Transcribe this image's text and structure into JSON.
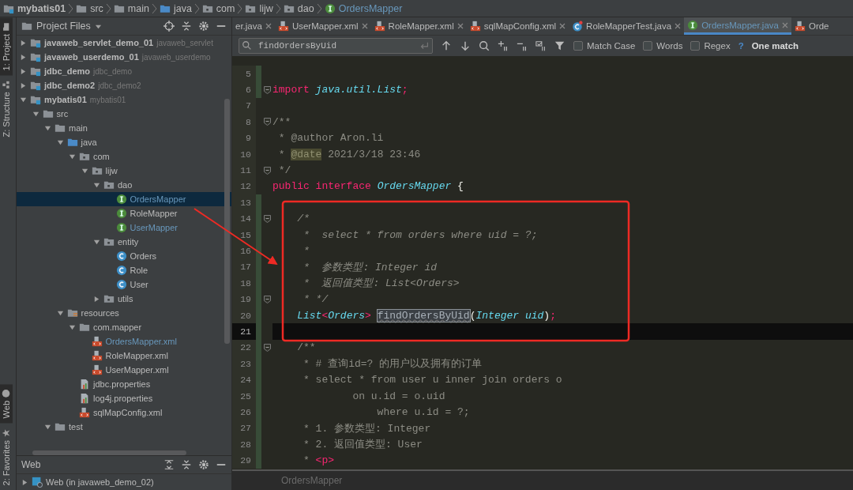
{
  "breadcrumb": [
    {
      "label": "mybatis01",
      "kind": "module"
    },
    {
      "label": "src",
      "kind": "folder"
    },
    {
      "label": "main",
      "kind": "folder"
    },
    {
      "label": "java",
      "kind": "source"
    },
    {
      "label": "com",
      "kind": "package"
    },
    {
      "label": "lijw",
      "kind": "package"
    },
    {
      "label": "dao",
      "kind": "package"
    },
    {
      "label": "OrdersMapper",
      "kind": "interface"
    }
  ],
  "tool_strip": {
    "top": [
      {
        "label": "1: Project",
        "kind": "project",
        "selected": true
      },
      {
        "label": "Z: Structure",
        "kind": "structure",
        "selected": false
      }
    ],
    "bottom": [
      {
        "label": "Web",
        "kind": "web",
        "selected": true
      },
      {
        "label": "2: Favorites",
        "kind": "favorites",
        "selected": false
      }
    ]
  },
  "project_panel": {
    "title": "Project Files",
    "tree": [
      {
        "label": "javaweb_servlet_demo_01",
        "module": "javaweb_servlet",
        "kind": "module",
        "expanded": false,
        "selected": false,
        "modified": false
      },
      {
        "label": "javaweb_userdemo_01",
        "module": "javaweb_userdemo",
        "kind": "module",
        "expanded": false,
        "selected": false,
        "modified": false
      },
      {
        "label": "jdbc_demo",
        "module": "jdbc_demo",
        "kind": "module",
        "expanded": false,
        "selected": false,
        "modified": false
      },
      {
        "label": "jdbc_demo2",
        "module": "jdbc_demo2",
        "kind": "module",
        "expanded": false,
        "selected": false,
        "modified": false
      },
      {
        "label": "mybatis01",
        "module": "mybatis01",
        "kind": "module",
        "expanded": true,
        "selected": false,
        "modified": false,
        "children": [
          {
            "label": "src",
            "kind": "folder",
            "expanded": true,
            "selected": false,
            "modified": false,
            "children": [
              {
                "label": "main",
                "kind": "folder",
                "expanded": true,
                "selected": false,
                "modified": false,
                "children": [
                  {
                    "label": "java",
                    "kind": "source",
                    "expanded": true,
                    "selected": false,
                    "modified": false,
                    "children": [
                      {
                        "label": "com",
                        "kind": "package",
                        "expanded": true,
                        "selected": false,
                        "modified": false,
                        "children": [
                          {
                            "label": "lijw",
                            "kind": "package",
                            "expanded": true,
                            "selected": false,
                            "modified": false,
                            "children": [
                              {
                                "label": "dao",
                                "kind": "package",
                                "expanded": true,
                                "selected": false,
                                "modified": false,
                                "children": [
                                  {
                                    "label": "OrdersMapper",
                                    "kind": "interface",
                                    "selected": true,
                                    "modified": true
                                  },
                                  {
                                    "label": "RoleMapper",
                                    "kind": "interface",
                                    "selected": false,
                                    "modified": false
                                  },
                                  {
                                    "label": "UserMapper",
                                    "kind": "interface",
                                    "selected": false,
                                    "modified": true
                                  }
                                ]
                              },
                              {
                                "label": "entity",
                                "kind": "package",
                                "expanded": true,
                                "selected": false,
                                "modified": false,
                                "children": [
                                  {
                                    "label": "Orders",
                                    "kind": "class",
                                    "selected": false,
                                    "modified": false
                                  },
                                  {
                                    "label": "Role",
                                    "kind": "class",
                                    "selected": false,
                                    "modified": false
                                  },
                                  {
                                    "label": "User",
                                    "kind": "class",
                                    "selected": false,
                                    "modified": false
                                  }
                                ]
                              },
                              {
                                "label": "utils",
                                "kind": "package",
                                "expanded": false,
                                "selected": false,
                                "modified": false
                              }
                            ]
                          }
                        ]
                      }
                    ]
                  },
                  {
                    "label": "resources",
                    "kind": "resources",
                    "expanded": true,
                    "selected": false,
                    "modified": false,
                    "children": [
                      {
                        "label": "com.mapper",
                        "kind": "folder",
                        "expanded": true,
                        "selected": false,
                        "modified": false,
                        "children": [
                          {
                            "label": "OrdersMapper.xml",
                            "kind": "xml",
                            "selected": false,
                            "modified": true
                          },
                          {
                            "label": "RoleMapper.xml",
                            "kind": "xml",
                            "selected": false,
                            "modified": false
                          },
                          {
                            "label": "UserMapper.xml",
                            "kind": "xml",
                            "selected": false,
                            "modified": false
                          }
                        ]
                      },
                      {
                        "label": "jdbc.properties",
                        "kind": "properties",
                        "selected": false,
                        "modified": false
                      },
                      {
                        "label": "log4j.properties",
                        "kind": "properties",
                        "selected": false,
                        "modified": false
                      },
                      {
                        "label": "sqlMapConfig.xml",
                        "kind": "xml",
                        "selected": false,
                        "modified": false
                      }
                    ]
                  }
                ]
              },
              {
                "label": "test",
                "kind": "folder",
                "expanded": true,
                "selected": false,
                "modified": false
              }
            ]
          }
        ]
      }
    ]
  },
  "web_panel": {
    "title": "Web",
    "items": [
      {
        "label": "Web (in javaweb_demo_02)",
        "kind": "web",
        "expanded": false
      }
    ]
  },
  "tabs": [
    {
      "label": "er.java",
      "kind": "none",
      "selected": false,
      "closable": true
    },
    {
      "label": "UserMapper.xml",
      "kind": "xml",
      "selected": false,
      "closable": true
    },
    {
      "label": "RoleMapper.xml",
      "kind": "xml",
      "selected": false,
      "closable": true
    },
    {
      "label": "sqlMapConfig.xml",
      "kind": "xml",
      "selected": false,
      "closable": true
    },
    {
      "label": "RoleMapperTest.java",
      "kind": "test-class",
      "selected": false,
      "closable": true
    },
    {
      "label": "OrdersMapper.java",
      "kind": "interface",
      "selected": true,
      "closable": true
    },
    {
      "label": "Orde",
      "kind": "xml",
      "selected": false,
      "closable": false
    }
  ],
  "find_bar": {
    "value": "findOrdersByUid",
    "options": [
      {
        "label": "Match Case",
        "checked": false
      },
      {
        "label": "Words",
        "checked": false
      },
      {
        "label": "Regex",
        "checked": false
      }
    ],
    "help": "?",
    "result": "One match"
  },
  "editor": {
    "lines": [
      {
        "number": "5",
        "changed": true,
        "fold": false,
        "current": false
      },
      {
        "number": "6",
        "changed": true,
        "fold": true,
        "current": false,
        "tokens": [
          {
            "text": "import ",
            "kind": "keyword"
          },
          {
            "text": "java.util.List",
            "kind": "type"
          },
          {
            "text": ";",
            "kind": "keyword"
          }
        ]
      },
      {
        "number": "7",
        "changed": false,
        "fold": false,
        "current": false
      },
      {
        "number": "8",
        "changed": false,
        "fold": true,
        "current": false,
        "tokens": [
          {
            "text": "/**",
            "kind": "doc"
          }
        ]
      },
      {
        "number": "9",
        "changed": false,
        "fold": false,
        "current": false,
        "tokens": [
          {
            "text": " * @author Aron.li",
            "kind": "doc"
          }
        ]
      },
      {
        "number": "10",
        "changed": false,
        "fold": false,
        "current": false,
        "tokens": [
          {
            "text": " * ",
            "kind": "doc"
          },
          {
            "text": "@date",
            "kind": "doc_tag"
          },
          {
            "text": " 2021/3/18 23:46",
            "kind": "doc"
          }
        ]
      },
      {
        "number": "11",
        "changed": false,
        "fold": true,
        "current": false,
        "tokens": [
          {
            "text": " */",
            "kind": "doc"
          }
        ]
      },
      {
        "number": "12",
        "changed": false,
        "fold": false,
        "current": false,
        "tokens": [
          {
            "text": "public interface ",
            "kind": "keyword"
          },
          {
            "text": "OrdersMapper",
            "kind": "type"
          },
          {
            "text": " {",
            "kind": "plain"
          }
        ]
      },
      {
        "number": "13",
        "changed": true,
        "fold": false,
        "current": false
      },
      {
        "number": "14",
        "changed": true,
        "fold": true,
        "current": false,
        "tokens": [
          {
            "text": "    /*",
            "kind": "comment"
          }
        ]
      },
      {
        "number": "15",
        "changed": true,
        "fold": false,
        "current": false,
        "tokens": [
          {
            "text": "     *  select * from orders where uid = ?;",
            "kind": "comment"
          }
        ]
      },
      {
        "number": "16",
        "changed": true,
        "fold": false,
        "current": false,
        "tokens": [
          {
            "text": "     *",
            "kind": "comment"
          }
        ]
      },
      {
        "number": "17",
        "changed": true,
        "fold": false,
        "current": false,
        "tokens": [
          {
            "text": "     *  参数类型: Integer id",
            "kind": "comment"
          }
        ]
      },
      {
        "number": "18",
        "changed": true,
        "fold": false,
        "current": false,
        "tokens": [
          {
            "text": "     *  返回值类型: List<Orders>",
            "kind": "comment"
          }
        ]
      },
      {
        "number": "19",
        "changed": true,
        "fold": true,
        "current": false,
        "tokens": [
          {
            "text": "     * */",
            "kind": "comment"
          }
        ]
      },
      {
        "number": "20",
        "changed": true,
        "fold": false,
        "current": false,
        "tokens": [
          {
            "text": "    List",
            "kind": "type"
          },
          {
            "text": "<",
            "kind": "keyword"
          },
          {
            "text": "Orders",
            "kind": "type"
          },
          {
            "text": "> ",
            "kind": "keyword"
          },
          {
            "text": "findOrdersByUid",
            "kind": "match"
          },
          {
            "text": "(",
            "kind": "plain"
          },
          {
            "text": "Integer uid",
            "kind": "type"
          },
          {
            "text": ")",
            "kind": "plain"
          },
          {
            "text": ";",
            "kind": "keyword"
          }
        ]
      },
      {
        "number": "21",
        "changed": true,
        "fold": false,
        "current": true
      },
      {
        "number": "22",
        "changed": true,
        "fold": true,
        "current": false,
        "tokens": [
          {
            "text": "    /**",
            "kind": "doc"
          }
        ]
      },
      {
        "number": "23",
        "changed": true,
        "fold": false,
        "current": false,
        "tokens": [
          {
            "text": "     * # 查询id=? 的用户以及拥有的订单",
            "kind": "doc"
          }
        ]
      },
      {
        "number": "24",
        "changed": true,
        "fold": false,
        "current": false,
        "tokens": [
          {
            "text": "     * select * from user u inner join orders o",
            "kind": "doc"
          }
        ]
      },
      {
        "number": "25",
        "changed": true,
        "fold": false,
        "current": false,
        "tokens": [
          {
            "text": "             on u.id = o.uid",
            "kind": "doc"
          }
        ]
      },
      {
        "number": "26",
        "changed": true,
        "fold": false,
        "current": false,
        "tokens": [
          {
            "text": "                 where u.id = ?;",
            "kind": "doc"
          }
        ]
      },
      {
        "number": "27",
        "changed": true,
        "fold": false,
        "current": false,
        "tokens": [
          {
            "text": "     * 1. 参数类型: Integer",
            "kind": "doc"
          }
        ]
      },
      {
        "number": "28",
        "changed": true,
        "fold": false,
        "current": false,
        "tokens": [
          {
            "text": "     * 2. 返回值类型: User",
            "kind": "doc"
          }
        ]
      },
      {
        "number": "29",
        "changed": true,
        "fold": false,
        "current": false,
        "tokens": [
          {
            "text": "     * ",
            "kind": "doc"
          },
          {
            "text": "<p>",
            "kind": "tag"
          }
        ]
      }
    ]
  },
  "status_breadcrumb": "OrdersMapper"
}
